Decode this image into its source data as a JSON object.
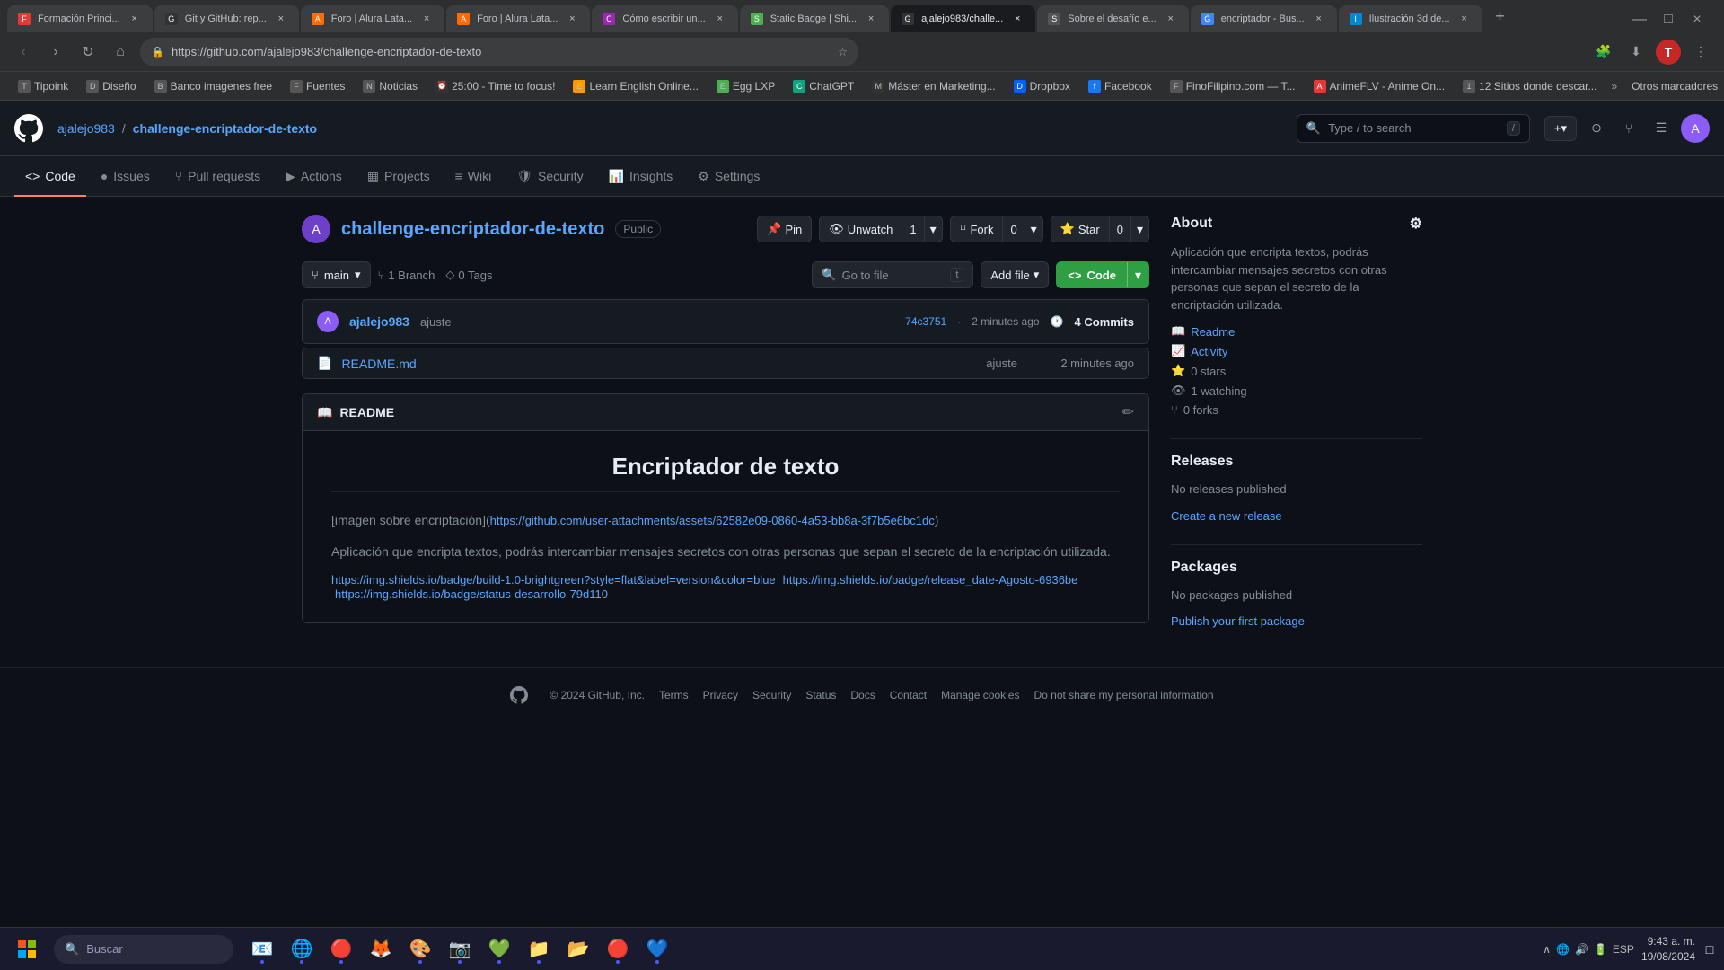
{
  "browser": {
    "tabs": [
      {
        "id": "t1",
        "favicon": "F",
        "title": "Formación Princi...",
        "active": false
      },
      {
        "id": "t2",
        "favicon": "G",
        "title": "Git y GitHub: rep...",
        "active": false
      },
      {
        "id": "t3",
        "favicon": "A",
        "title": "Foro | Alura Lata...",
        "active": false
      },
      {
        "id": "t4",
        "favicon": "A",
        "title": "Foro | Alura Lata...",
        "active": false
      },
      {
        "id": "t5",
        "favicon": "C",
        "title": "Cómo escribir un...",
        "active": false
      },
      {
        "id": "t6",
        "favicon": "S",
        "title": "Static Badge | Shi...",
        "active": false
      },
      {
        "id": "t7",
        "favicon": "G",
        "title": "ajalejo983/challe...",
        "active": true
      },
      {
        "id": "t8",
        "favicon": "S",
        "title": "Sobre el desafío e...",
        "active": false
      },
      {
        "id": "t9",
        "favicon": "G",
        "title": "encriptador - Bus...",
        "active": false
      },
      {
        "id": "t10",
        "favicon": "I",
        "title": "Ilustración 3d de...",
        "active": false
      }
    ],
    "url": "https://github.com/ajalejo983/challenge-encriptador-de-texto",
    "bookmarks": [
      {
        "label": "Tipoink"
      },
      {
        "label": "Diseño"
      },
      {
        "label": "Banco imagenes free"
      },
      {
        "label": "Fuentes"
      },
      {
        "label": "Noticias"
      },
      {
        "label": "25:00 - Time to focus!"
      },
      {
        "label": "Learn English Online..."
      },
      {
        "label": "Egg LXP"
      },
      {
        "label": "ChatGPT"
      },
      {
        "label": "Máster en Marketing..."
      },
      {
        "label": "Dropbox"
      },
      {
        "label": "Facebook"
      },
      {
        "label": "FinoFilipino.com — T..."
      },
      {
        "label": "AnimeFLV - Anime On..."
      },
      {
        "label": "12 Sitios donde descar..."
      }
    ]
  },
  "github": {
    "logo": "⬡",
    "user": "ajalejo983",
    "repo": "challenge-encriptador-de-texto",
    "search_placeholder": "Type / to search",
    "nav_items": [
      {
        "label": "Code",
        "icon": "<>",
        "active": true
      },
      {
        "label": "Issues",
        "icon": "●",
        "count": null
      },
      {
        "label": "Pull requests",
        "icon": "⑂",
        "count": null
      },
      {
        "label": "Actions",
        "icon": "▶",
        "count": null
      },
      {
        "label": "Projects",
        "icon": "▦",
        "count": null
      },
      {
        "label": "Wiki",
        "icon": "≡",
        "count": null
      },
      {
        "label": "Security",
        "icon": "🛡",
        "count": null
      },
      {
        "label": "Insights",
        "icon": "📊",
        "count": null
      },
      {
        "label": "Settings",
        "icon": "⚙",
        "count": null
      }
    ],
    "repo_title": "challenge-encriptador-de-texto",
    "visibility": "Public",
    "actions": {
      "pin": "Pin",
      "watch": "Unwatch",
      "watch_count": "1",
      "fork": "Fork",
      "fork_count": "0",
      "star": "Star",
      "star_count": "0"
    },
    "branch": {
      "name": "main",
      "branch_count": "1 Branch",
      "tag_count": "0 Tags"
    },
    "go_to_file": "Go to file",
    "add_file": "Add file",
    "code_btn": "Code",
    "commit": {
      "avatar": "A",
      "author": "ajalejo983",
      "message": "ajuste",
      "hash": "74c3751",
      "time": "2 minutes ago",
      "commits_label": "4 Commits"
    },
    "files": [
      {
        "icon": "📄",
        "name": "README.md",
        "commit": "ajuste",
        "time": "2 minutes ago"
      }
    ],
    "readme": {
      "title": "README",
      "heading": "Encriptador de texto",
      "image_text": "[imagen sobre encriptación]",
      "image_link": "https://github.com/user-attachments/assets/62582e09-0860-4a53-bb8a-3f7b5e6bc1dc",
      "description": "Aplicación que encripta textos, podrás intercambiar mensajes secretos con otras personas que sepan el secreto de la encriptación utilizada.",
      "badge1": "https://img.shields.io/badge/build-1.0-brightgreen?style=flat&label=version&color=blue",
      "badge2": "https://img.shields.io/badge/release_date-Agosto-6936be",
      "badge3": "https://img.shields.io/badge/status-desarrollo-79d110"
    },
    "about": {
      "title": "About",
      "description": "Aplicación que encripta textos, podrás intercambiar mensajes secretos con otras personas que sepan el secreto de la encriptación utilizada.",
      "readme_link": "Readme",
      "activity_link": "Activity",
      "stars": "0 stars",
      "watching": "1 watching",
      "forks": "0 forks"
    },
    "releases": {
      "title": "Releases",
      "no_releases": "No releases published",
      "create_link": "Create a new release"
    },
    "packages": {
      "title": "Packages",
      "no_packages": "No packages published",
      "publish_link": "Publish your first package"
    }
  },
  "footer": {
    "copyright": "© 2024 GitHub, Inc.",
    "links": [
      "Terms",
      "Privacy",
      "Security",
      "Status",
      "Docs",
      "Contact",
      "Manage cookies",
      "Do not share my personal information"
    ]
  },
  "taskbar": {
    "search_placeholder": "Buscar",
    "time": "9:43 a. m.",
    "date": "19/08/2024",
    "lang": "ESP",
    "apps": [
      "📧",
      "🌐",
      "🔴",
      "🦊",
      "🎨",
      "📷",
      "💚",
      "📁",
      "📂",
      "🔴",
      "💙"
    ]
  }
}
